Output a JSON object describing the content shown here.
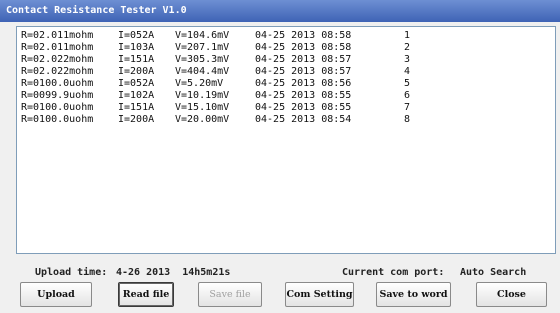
{
  "window": {
    "title": "Contact Resistance Tester V1.0"
  },
  "records": [
    {
      "r": "R=02.011mohm",
      "i": "I=052A",
      "v": "V=104.6mV",
      "dt": "04-25 2013 08:58",
      "n": "1"
    },
    {
      "r": "R=02.011mohm",
      "i": "I=103A",
      "v": "V=207.1mV",
      "dt": "04-25 2013 08:58",
      "n": "2"
    },
    {
      "r": "R=02.022mohm",
      "i": "I=151A",
      "v": "V=305.3mV",
      "dt": "04-25 2013 08:57",
      "n": "3"
    },
    {
      "r": "R=02.022mohm",
      "i": "I=200A",
      "v": "V=404.4mV",
      "dt": "04-25 2013 08:57",
      "n": "4"
    },
    {
      "r": "R=0100.0uohm",
      "i": "I=052A",
      "v": "V=5.20mV",
      "dt": "04-25 2013 08:56",
      "n": "5"
    },
    {
      "r": "R=0099.9uohm",
      "i": "I=102A",
      "v": "V=10.19mV",
      "dt": "04-25 2013 08:55",
      "n": "6"
    },
    {
      "r": "R=0100.0uohm",
      "i": "I=151A",
      "v": "V=15.10mV",
      "dt": "04-25 2013 08:55",
      "n": "7"
    },
    {
      "r": "R=0100.0uohm",
      "i": "I=200A",
      "v": "V=20.00mV",
      "dt": "04-25 2013 08:54",
      "n": "8"
    }
  ],
  "status": {
    "upload_time_label": "Upload time:",
    "upload_time_value": "4-26 2013  14h5m21s",
    "com_port_label": "Current com port:",
    "com_port_value": "Auto Search"
  },
  "buttons": {
    "upload": "Upload",
    "read_file": "Read file",
    "save_file": "Save file",
    "com_setting": "Com Setting",
    "save_to_word": "Save to word",
    "close": "Close"
  }
}
